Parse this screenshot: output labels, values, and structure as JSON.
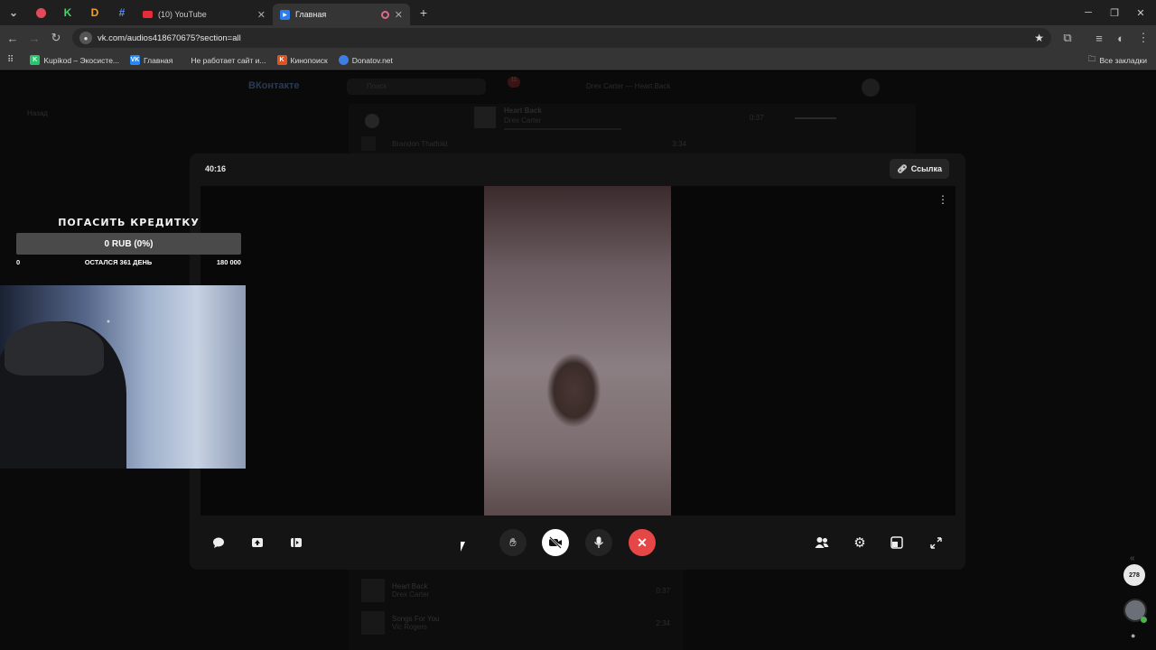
{
  "browser": {
    "tabs": [
      {
        "label": "(10) YouTube"
      },
      {
        "label": "Главная"
      }
    ],
    "url": "vk.com/audios418670675?section=all",
    "bookmarks": [
      {
        "label": "Kupikod – Экосисте..."
      },
      {
        "label": "Главная"
      },
      {
        "label": "Не работает сайт и..."
      },
      {
        "label": "Кинопоиск"
      },
      {
        "label": "Donatov.net"
      }
    ],
    "all_bookmarks": "Все закладки"
  },
  "vk": {
    "logo": "ВКонтакте",
    "search_placeholder": "Поиск",
    "notifications_count": "11",
    "now_playing_header": "Drex Carter — Heart Back",
    "player_track": "Heart Back",
    "player_artist": "Drex Carter",
    "player_time": "0:37",
    "back_link": "Назад",
    "tracks": [
      {
        "title": "Brandon Thatfold",
        "artist": "",
        "duration": "3:34"
      },
      {
        "title": "Heart Back",
        "artist": "Drex Carter",
        "duration": "0:37"
      },
      {
        "title": "Songs For You",
        "artist": "Vic Rogers",
        "duration": "2:34"
      }
    ]
  },
  "call": {
    "timer": "40:16",
    "link_label": "Ссылка",
    "end_call_color": "#e64646"
  },
  "overlay": {
    "title": "ПОГАСИТЬ КРЕДИТКУ",
    "amount": "0 RUB (0%)",
    "min": "0",
    "remaining": "ОСТАЛСЯ 361 ДЕНЬ",
    "max": "180 000",
    "progress": 0
  },
  "sidebar": {
    "badge": "278"
  }
}
